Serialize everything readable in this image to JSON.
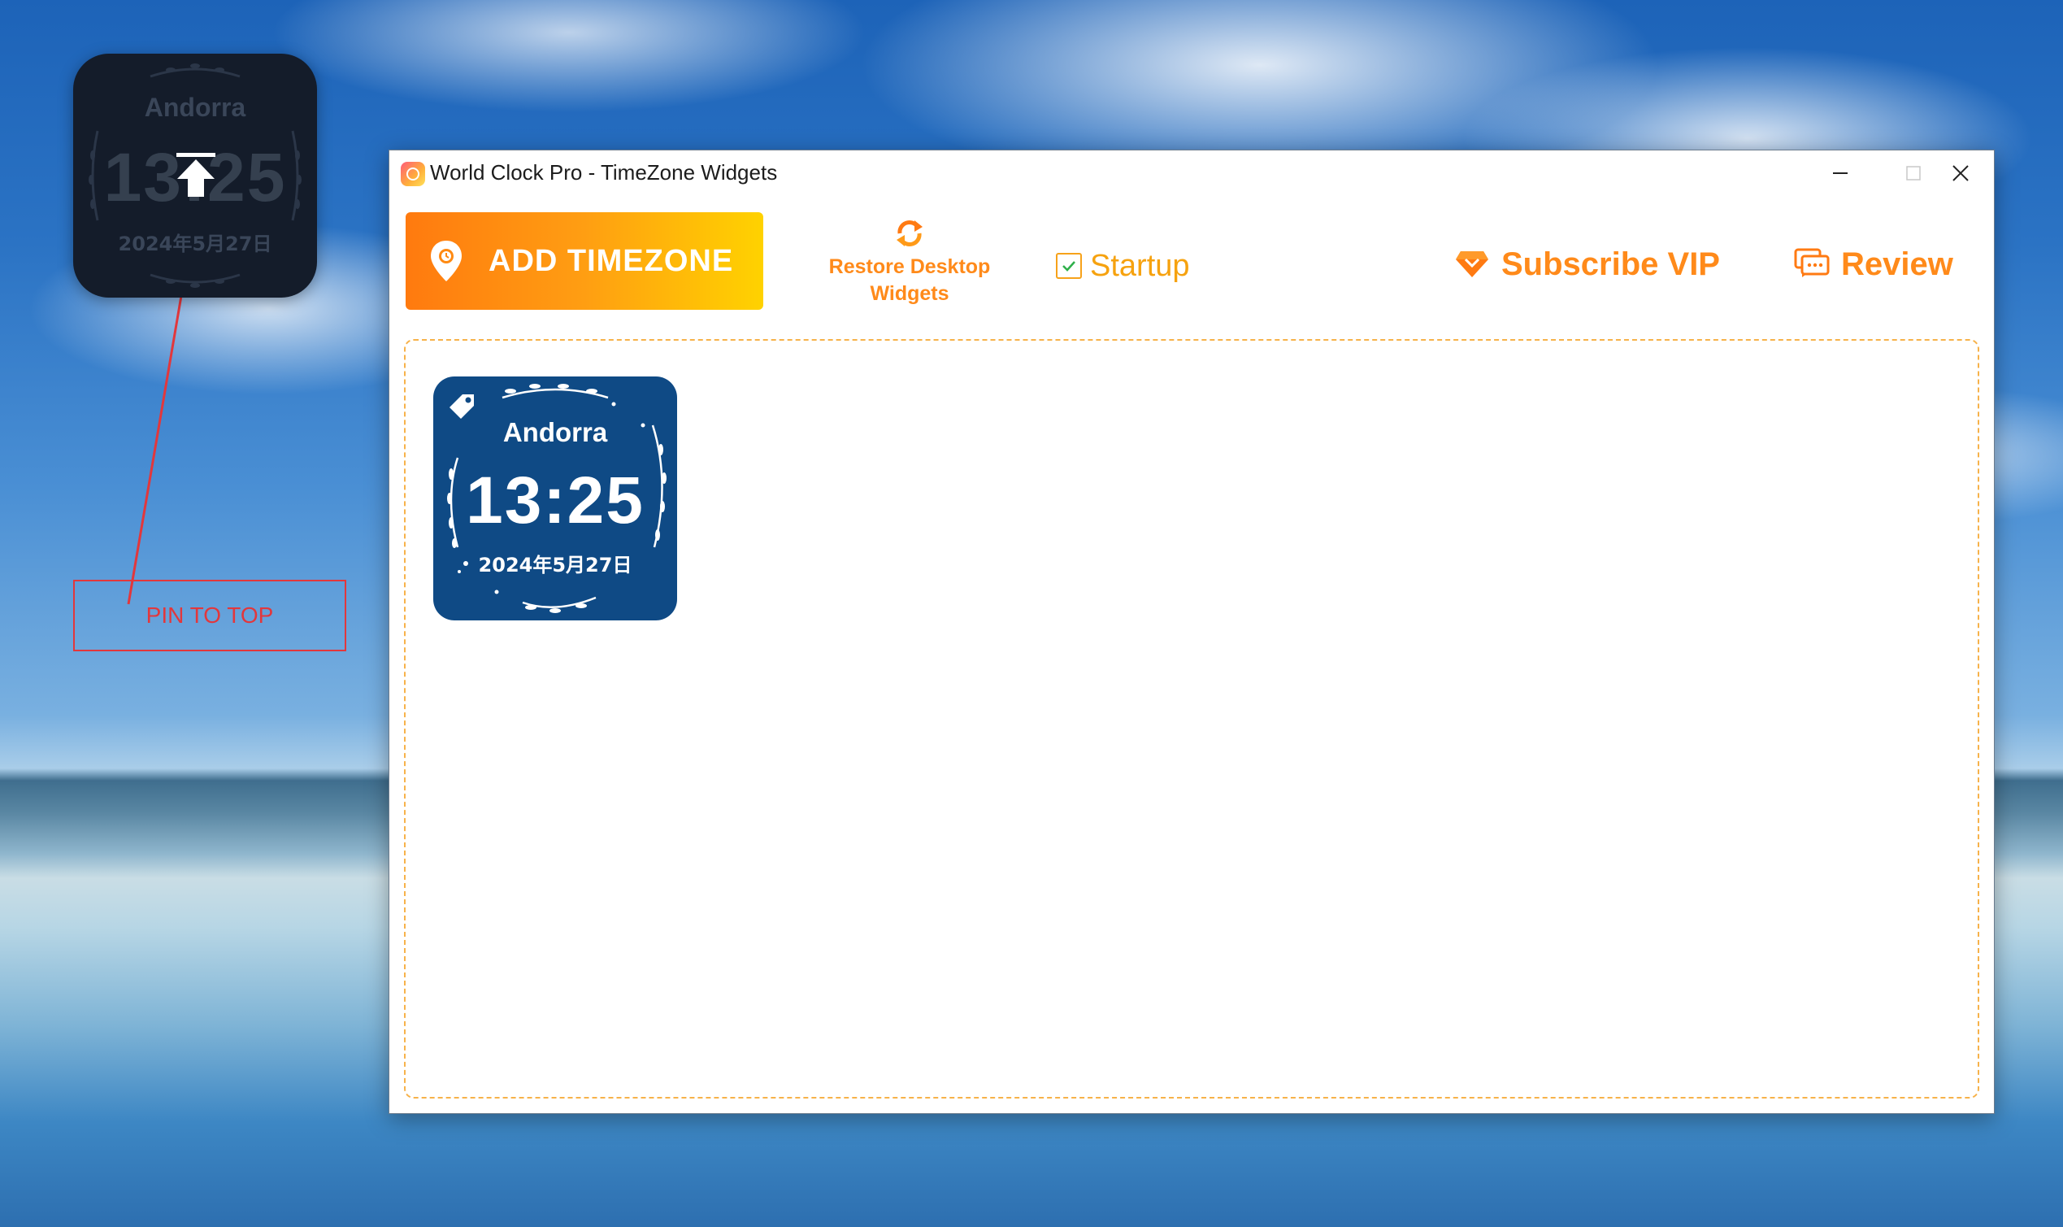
{
  "desktop_widget": {
    "city": "Andorra",
    "time": "13:25",
    "date": "2024年5月27日"
  },
  "annotation": {
    "label": "PIN TO TOP",
    "color": "#e2373c"
  },
  "window": {
    "title": "World Clock Pro - TimeZone Widgets",
    "controls": {
      "minimize": "—",
      "maximize": "☐",
      "close": "✕"
    }
  },
  "toolbar": {
    "add_timezone": "ADD TIMEZONE",
    "restore_line1": "Restore Desktop",
    "restore_line2": "Widgets",
    "startup_label": "Startup",
    "startup_checked": true,
    "subscribe_vip": "Subscribe VIP",
    "review": "Review"
  },
  "widgets": [
    {
      "city": "Andorra",
      "time": "13:25",
      "date": "2024年5月27日",
      "bg": "#0f4a85"
    }
  ],
  "colors": {
    "accent_orange": "#ff8a1a",
    "accent_yellow": "#ffd200",
    "widget_blue": "#0f4a85"
  }
}
